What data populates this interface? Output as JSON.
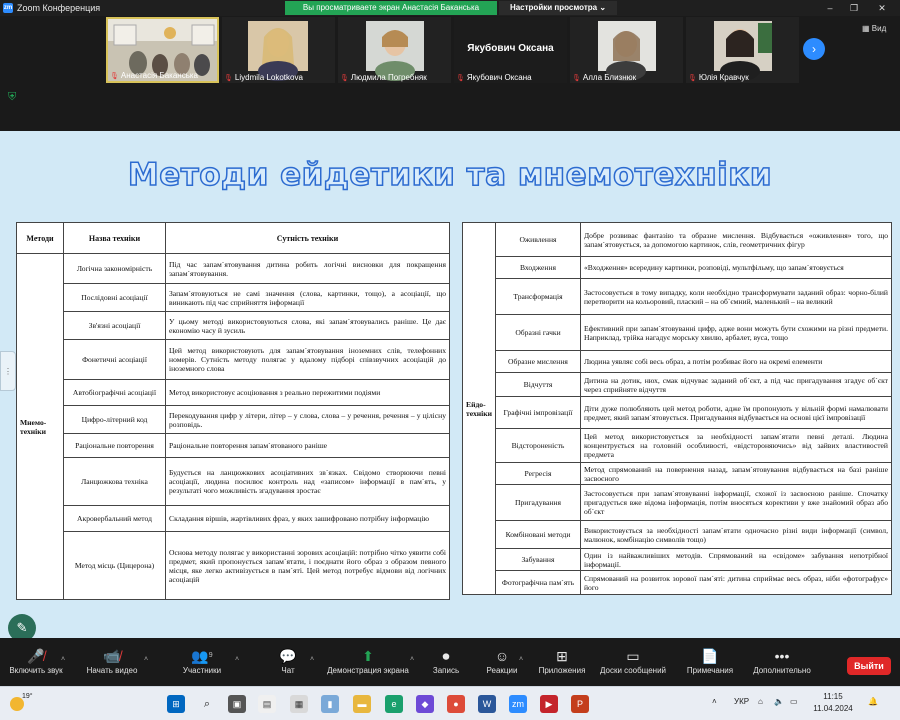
{
  "window": {
    "app_title": "Zoom Конференция",
    "share_banner": "Вы просматриваете экран Анастасія Баканська",
    "view_options": "Настройки просмотра"
  },
  "gallery": {
    "view_label": "Вид",
    "participants": [
      {
        "name": "Анастасія Баканська",
        "video": true,
        "active": true
      },
      {
        "name": "Liydmila Lokotkova",
        "video": true
      },
      {
        "name": "Людмила Погребняк",
        "video": true
      },
      {
        "name": "Якубович Оксана",
        "video": false,
        "display": "Якубович Оксана"
      },
      {
        "name": "Алла Близнюк",
        "video": true
      },
      {
        "name": "Юлія Кравчук",
        "video": true
      }
    ]
  },
  "slide": {
    "title": "Методи ейдетики та мнемотехніки",
    "left_table": {
      "headers": [
        "Методи",
        "Назва техніки",
        "Сутність техніки"
      ],
      "group": "Мнемо-техніки",
      "rows": [
        [
          "Логічна закономірність",
          "Під час запам`ятовування дитина робить логічні висновки для покращення запам`ятовування."
        ],
        [
          "Послідовні асоціації",
          "Запам`ятовуються не самі значення (слова, картинки, тощо), а асоціації, що виникають під час сприйняття інформації"
        ],
        [
          "Зв'язні асоціації",
          "У цьому методі використовуються слова, які запам`ятовувались раніше. Це дає економію часу й зусиль"
        ],
        [
          "Фонетичні асоціації",
          "Цей метод використовують для запам`ятовування іноземних слів, телефонних номерів. Сутність методу полягає у вдалому підборі співзвучних асоціацій до іноземного слова"
        ],
        [
          "Автобіографічні асоціації",
          "Метод використовує асоціювання з реально пережитими подіями"
        ],
        [
          "Цифро-літерний код",
          "Перекодування цифр у літери, літер – у слова, слова – у речення, речення – у цілісну розповідь."
        ],
        [
          "Раціональне повторення",
          "Раціональне повторення запам`ятованого раніше"
        ],
        [
          "Ланцюжкова техніка",
          "Будується на ланцюжкових асоціативних зв`язках. Свідомо створюючи певні асоціації, людина посилює контроль над «записом» інформації в пам`ять, у результаті чого можливість згадування зростає"
        ],
        [
          "Акровербальний метод",
          "Складання віршів, жартівливих фраз, у яких зашифровано потрібну інформацію"
        ],
        [
          "Метод місць (Цицерона)",
          "Основа методу полягає у використанні зорових асоціацій: потрібно чітко уявити собі предмет, який пропонується запам`ятати, і поєднати його образ з образом певного місця, яке легко активізується в пам`яті. Цей метод потребує відмови від логічних асоціацій"
        ]
      ]
    },
    "right_table": {
      "group": "Ейдо-техніки",
      "rows": [
        [
          "Оживлення",
          "Добре розвиває фантазію та образне мислення. Відбувається «оживлення» того, що запам`ятовується, за допомогою картинок, слів, геометричних фігур"
        ],
        [
          "Входження",
          "«Входження» всередину картинки, розповіді, мультфільму, що запам`ятовується"
        ],
        [
          "Трансформація",
          "Застосовується в тому випадку, коли необхідно трансформувати заданий образ: чорно-білий перетворити на кольоровий, плаский – на об`ємний, маленький – на великий"
        ],
        [
          "Образні гачки",
          "Ефективний при запам`ятовуванні цифр, адже вони можуть бути схожими на різні предмети. Наприклад, трійка нагадує морську хвилю, арбалет, вуса, тощо"
        ],
        [
          "Образне мислення",
          "Людина уявляє собі весь образ, а потім розбиває його на окремі елементи"
        ],
        [
          "Відчуття",
          "Дитина на дотик, нюх, смак відчуває заданий об`єкт, а під час пригадування згадує об`єкт через сприйняте відчуття"
        ],
        [
          "Графічні імпровізації",
          "Діти дуже полюбляють цей метод роботи, адже їм пропонують у вільній формі намалювати предмет, який запам`ятовується. Пригадування відбувається на основі цієї імпровізації"
        ],
        [
          "Відстороненість",
          "Цей метод використовується за необхідності запам`ятати певні деталі. Людина концентрується на головній особливості, «відстороняючись» від зайвих властивостей предмета"
        ],
        [
          "Регресія",
          "Метод спрямований на повернення назад, запам`ятовування відбувається на базі раніше засвоєного"
        ],
        [
          "Пригадування",
          "Застосовується при запам`ятовуванні інформації, схожої із засвоєною раніше. Спочатку пригадується вже відома інформація, потім вносяться корективи у вже знайомий образ або об`єкт"
        ],
        [
          "Комбіновані методи",
          "Використовується за необхідності запам`ятати одночасно різні види інформації (символ, малюнок, комбінацію символів тощо)"
        ],
        [
          "Забування",
          "Один із найважливіших методів. Спрямований на «свідоме» забування непотрібної інформації."
        ],
        [
          "Фотографічна пам`ять",
          "Спрямований на розвиток зорової пам`яті: дитина сприймає весь образ, ніби «фотографує» його"
        ]
      ]
    }
  },
  "toolbar": {
    "mute": "Включить звук",
    "video": "Начать видео",
    "participants": "Участники",
    "participants_count": "9",
    "chat": "Чат",
    "share": "Демонстрация экрана",
    "record": "Запись",
    "reactions": "Реакции",
    "apps": "Приложения",
    "whiteboards": "Доски сообщений",
    "notes": "Примечания",
    "more": "Дополнительно",
    "leave": "Выйти"
  },
  "taskbar": {
    "temperature": "19°",
    "lang": "УКР",
    "time": "11:15",
    "date": "11.04.2024"
  }
}
